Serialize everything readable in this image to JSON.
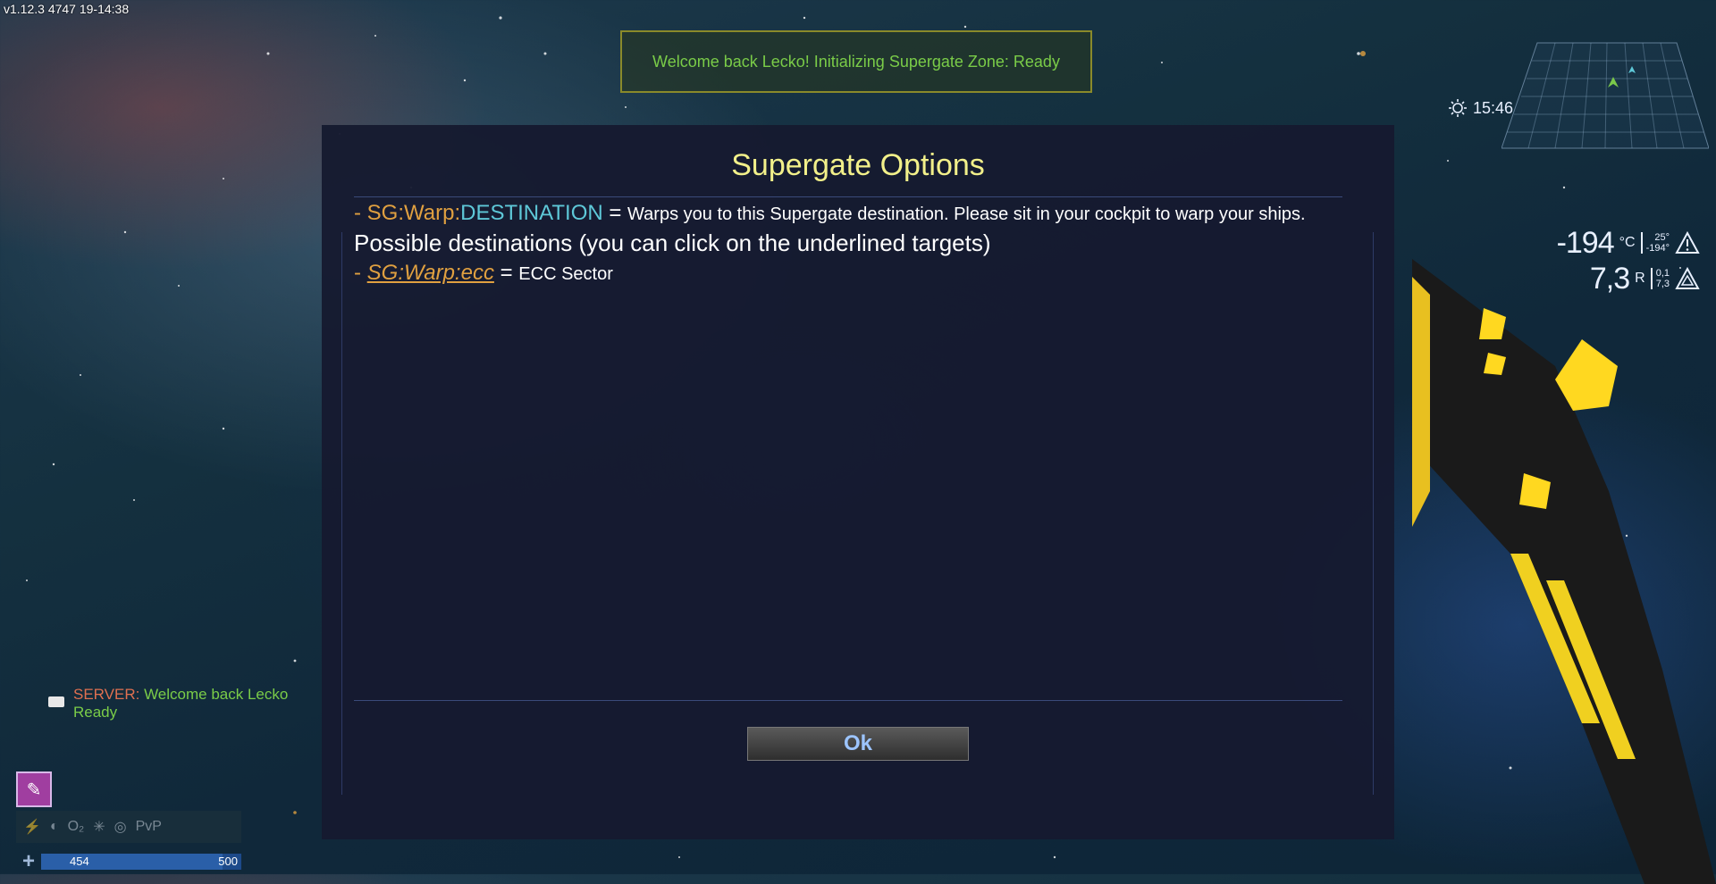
{
  "hud": {
    "version": "v1.12.3 4747 19-14:38",
    "banner": "Welcome back Lecko! Initializing Supergate Zone: Ready",
    "time": "15:46",
    "temperature": "-194",
    "temperature_unit": "°C",
    "temperature_range_top": "25°",
    "temperature_range_bottom": "-194°",
    "radiation": "7,3",
    "radiation_unit": "R",
    "radiation_range_top": "0,1",
    "radiation_range_bottom": "7,3"
  },
  "chat": {
    "sender": "SERVER:",
    "message": "Welcome back Lecko",
    "message_cont": "Ready"
  },
  "player": {
    "stats_label": "PvP",
    "health_current": "454",
    "health_max": "500",
    "health_fraction": 0.908
  },
  "dialog": {
    "title": "Supergate Options",
    "cmd_prefix": "- SG:Warp:",
    "cmd_dest": "DESTINATION",
    "cmd_eq": " = ",
    "cmd_desc": "Warps you to this Supergate destination. Please sit in your cockpit to warp your ships.",
    "possible": "Possible destinations (you can click on the underlined targets)",
    "dest_dash": "- ",
    "dest_link": "SG:Warp:ecc",
    "dest_eq": " = ",
    "dest_name": "ECC Sector",
    "ok_label": "Ok"
  },
  "colors": {
    "title": "#f2f08a",
    "orange": "#e0a040",
    "cyan": "#5ec8d8",
    "ok_text": "#9cc4ff",
    "banner_text": "#7acc48"
  }
}
